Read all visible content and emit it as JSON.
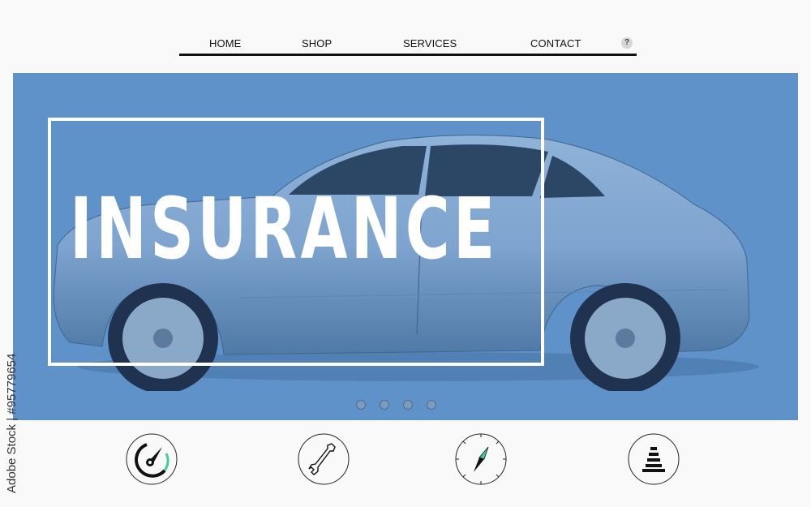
{
  "nav": {
    "items": [
      {
        "label": "HOME"
      },
      {
        "label": "SHOP"
      },
      {
        "label": "SERVICES"
      },
      {
        "label": "CONTACT"
      }
    ],
    "help_label": "?"
  },
  "hero": {
    "title": "INSURANCE",
    "background_color": "#5e92c8",
    "image": "car-side-view",
    "carousel": {
      "dot_count": 4
    }
  },
  "features": [
    {
      "icon": "speedometer-icon"
    },
    {
      "icon": "wrench-icon"
    },
    {
      "icon": "compass-icon"
    },
    {
      "icon": "traffic-cone-icon"
    }
  ],
  "accent_color": "#3ecf9a",
  "watermark": "Adobe Stock | #95779654"
}
